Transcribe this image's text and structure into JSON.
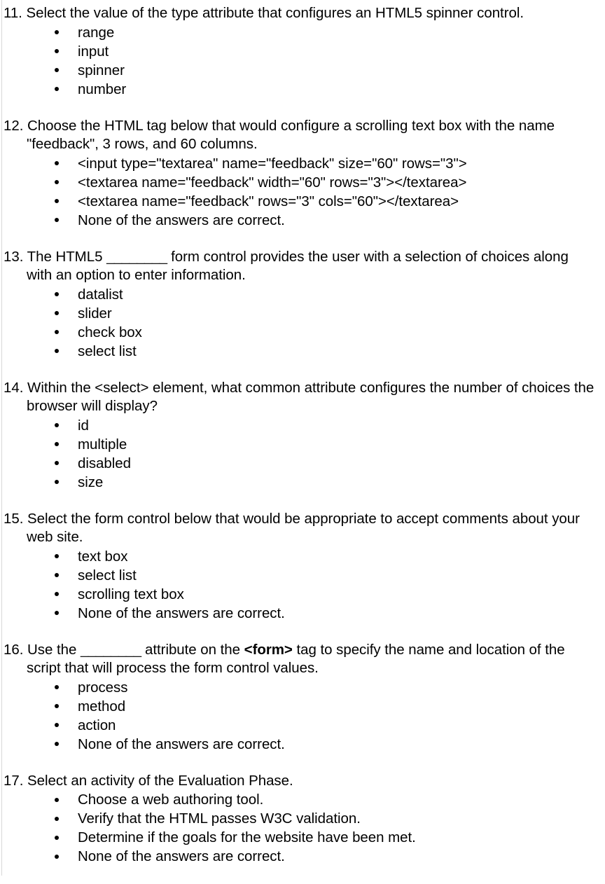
{
  "page": {
    "background_color": "#ffffff",
    "text_color": "#000000",
    "questions": [
      {
        "number": "11.",
        "prompt": "Select the value of the type attribute that configures an HTML5 spinner control.",
        "choices": [
          "range",
          "input",
          "spinner",
          "number"
        ]
      },
      {
        "number": "12.",
        "prompt": "Choose the HTML tag below that would configure a scrolling text box with the name \"feedback\", 3 rows, and 60 columns.",
        "choices": [
          "<input type=\"textarea\" name=\"feedback\" size=\"60\" rows=\"3\">",
          "<textarea name=\"feedback\" width=\"60\" rows=\"3\"></textarea>",
          "<textarea name=\"feedback\" rows=\"3\" cols=\"60\"></textarea>",
          "None of the answers are correct."
        ]
      },
      {
        "number": "13.",
        "prompt_before_blank": "The HTML5 ",
        "blank": "________",
        "prompt_after_blank": " form control provides the user with a selection of choices along with an option to enter information.",
        "choices": [
          "datalist",
          "slider",
          "check box",
          "select list"
        ]
      },
      {
        "number": "14.",
        "prompt": "Within the <select> element, what common attribute configures the number of choices the browser will display?",
        "choices": [
          "id",
          "multiple",
          "disabled",
          "size"
        ]
      },
      {
        "number": "15.",
        "prompt": "Select the form control below that would be appropriate to accept comments about your web site.",
        "choices": [
          "text box",
          "select list",
          "scrolling text box",
          "None of the answers are correct."
        ]
      },
      {
        "number": "16.",
        "prompt_before_blank": "Use the ",
        "blank": "________",
        "prompt_middle": " attribute on the ",
        "bold_term": "<form>",
        "prompt_after_blank": " tag to specify the name and location of the script that will process the form control values.",
        "choices": [
          "process",
          "method",
          "action",
          "None of the answers are correct."
        ]
      },
      {
        "number": "17.",
        "prompt": "Select an activity of the Evaluation Phase.",
        "choices": [
          "Choose a web authoring tool.",
          "Verify that the HTML passes W3C validation.",
          "Determine if the goals for the website have been met.",
          "None of the answers are correct."
        ]
      }
    ]
  }
}
